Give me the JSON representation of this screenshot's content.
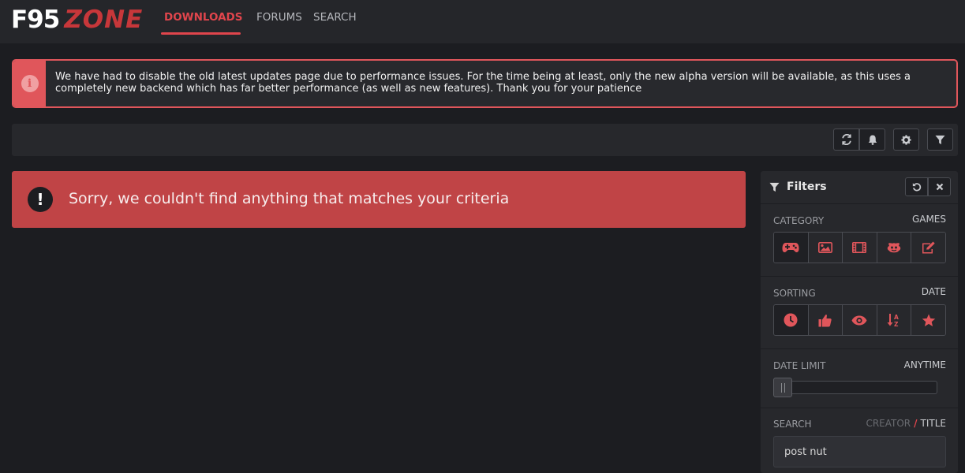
{
  "logo": {
    "part1": "F95",
    "part2": "ZONE"
  },
  "nav": {
    "downloads": "DOWNLOADS",
    "forums": "FORUMS",
    "search": "SEARCH"
  },
  "notice": {
    "icon": "info-icon",
    "text": "We have had to disable the old latest updates page due to performance issues. For the time being at least, only the new alpha version will be available, as this uses a completely new backend which has far better performance (as well as new features). Thank you for your patience"
  },
  "toolbar": {
    "icons": [
      "refresh-icon",
      "bell-icon",
      "gear-icon",
      "filter-icon"
    ]
  },
  "error": {
    "icon": "exclamation-icon",
    "text": "Sorry, we couldn't find anything that matches your criteria"
  },
  "filters": {
    "title": "Filters",
    "category": {
      "label": "CATEGORY",
      "value": "GAMES",
      "icons": [
        "gamepad-icon",
        "image-icon",
        "film-icon",
        "comics-icon",
        "edit-icon"
      ],
      "active_index": 0
    },
    "sorting": {
      "label": "SORTING",
      "value": "DATE",
      "icons": [
        "clock-icon",
        "thumbs-up-icon",
        "eye-icon",
        "sort-alpha-icon",
        "star-icon"
      ],
      "active_index": 0
    },
    "date_limit": {
      "label": "DATE LIMIT",
      "value": "ANYTIME",
      "level": 0
    },
    "search": {
      "label": "SEARCH",
      "creator": "CREATOR",
      "separator": "/",
      "title": "TITLE",
      "value": "post nut"
    }
  },
  "colors": {
    "accent": "#e0454c",
    "error_bg": "#c04446",
    "bg": "#1c1d21",
    "panel": "#27282c"
  }
}
